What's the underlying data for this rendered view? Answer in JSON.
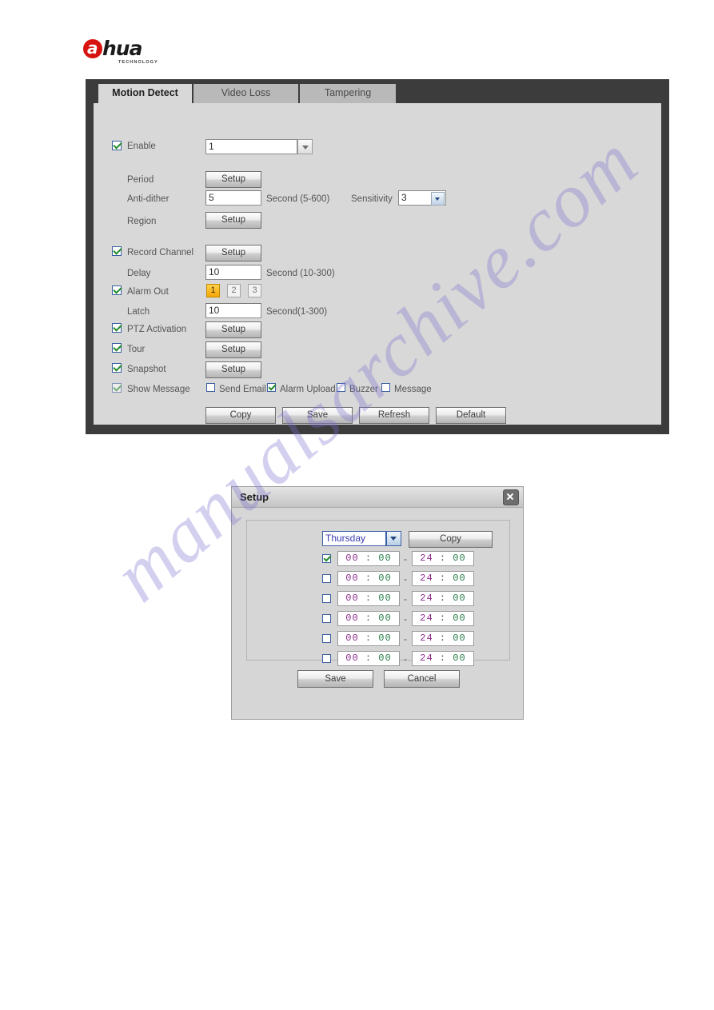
{
  "brand": {
    "logo_letter": "a",
    "logo_word": "hua",
    "logo_sub": "TECHNOLOGY"
  },
  "watermark": {
    "text": "manualsarchive.com"
  },
  "tabs": [
    {
      "label": "Motion Detect",
      "active": true
    },
    {
      "label": "Video Loss",
      "active": false
    },
    {
      "label": "Tampering",
      "active": false
    }
  ],
  "form": {
    "enable": {
      "label": "Enable",
      "checked": true,
      "value": "1"
    },
    "period": {
      "label": "Period",
      "button": "Setup"
    },
    "anti_dither": {
      "label": "Anti-dither",
      "value": "5",
      "unit": "Second (5-600)"
    },
    "sensitivity": {
      "label": "Sensitivity",
      "value": "3"
    },
    "region": {
      "label": "Region",
      "button": "Setup"
    },
    "record_channel": {
      "label": "Record Channel",
      "checked": true,
      "button": "Setup"
    },
    "delay": {
      "label": "Delay",
      "value": "10",
      "unit": "Second (10-300)"
    },
    "alarm_out": {
      "label": "Alarm Out",
      "checked": true,
      "channels": [
        {
          "label": "1",
          "selected": true
        },
        {
          "label": "2",
          "selected": false
        },
        {
          "label": "3",
          "selected": false
        }
      ]
    },
    "latch": {
      "label": "Latch",
      "value": "10",
      "unit": "Second(1-300)"
    },
    "ptz_activation": {
      "label": "PTZ Activation",
      "checked": true,
      "button": "Setup"
    },
    "tour": {
      "label": "Tour",
      "checked": true,
      "button": "Setup"
    },
    "snapshot": {
      "label": "Snapshot",
      "checked": true,
      "button": "Setup"
    },
    "show_message": {
      "label": "Show Message",
      "checked": true
    },
    "notify_options": [
      {
        "label": "Send Email",
        "checked": false
      },
      {
        "label": "Alarm Upload",
        "checked": true
      },
      {
        "label": "Buzzer",
        "checked": false
      },
      {
        "label": "Message",
        "checked": false
      }
    ],
    "actions": [
      {
        "label": "Copy"
      },
      {
        "label": "Save"
      },
      {
        "label": "Refresh"
      },
      {
        "label": "Default"
      }
    ]
  },
  "dialog": {
    "title": "Setup",
    "close_icon": "close-icon",
    "day": "Thursday",
    "copy_label": "Copy",
    "separator": "-",
    "periods": [
      {
        "checked": true,
        "start_h": "00",
        "start_m": "00",
        "end_h": "24",
        "end_m": "00"
      },
      {
        "checked": false,
        "start_h": "00",
        "start_m": "00",
        "end_h": "24",
        "end_m": "00"
      },
      {
        "checked": false,
        "start_h": "00",
        "start_m": "00",
        "end_h": "24",
        "end_m": "00"
      },
      {
        "checked": false,
        "start_h": "00",
        "start_m": "00",
        "end_h": "24",
        "end_m": "00"
      },
      {
        "checked": false,
        "start_h": "00",
        "start_m": "00",
        "end_h": "24",
        "end_m": "00"
      },
      {
        "checked": false,
        "start_h": "00",
        "start_m": "00",
        "end_h": "24",
        "end_m": "00"
      }
    ],
    "save_label": "Save",
    "cancel_label": "Cancel"
  },
  "colors": {
    "panel_border": "#3c3c3c",
    "panel_bg": "#d8d8d8",
    "accent_orange": "#f7a705",
    "brand_red": "#d6130f",
    "check_green": "#1f8a28",
    "watermark": "#786ecd"
  }
}
